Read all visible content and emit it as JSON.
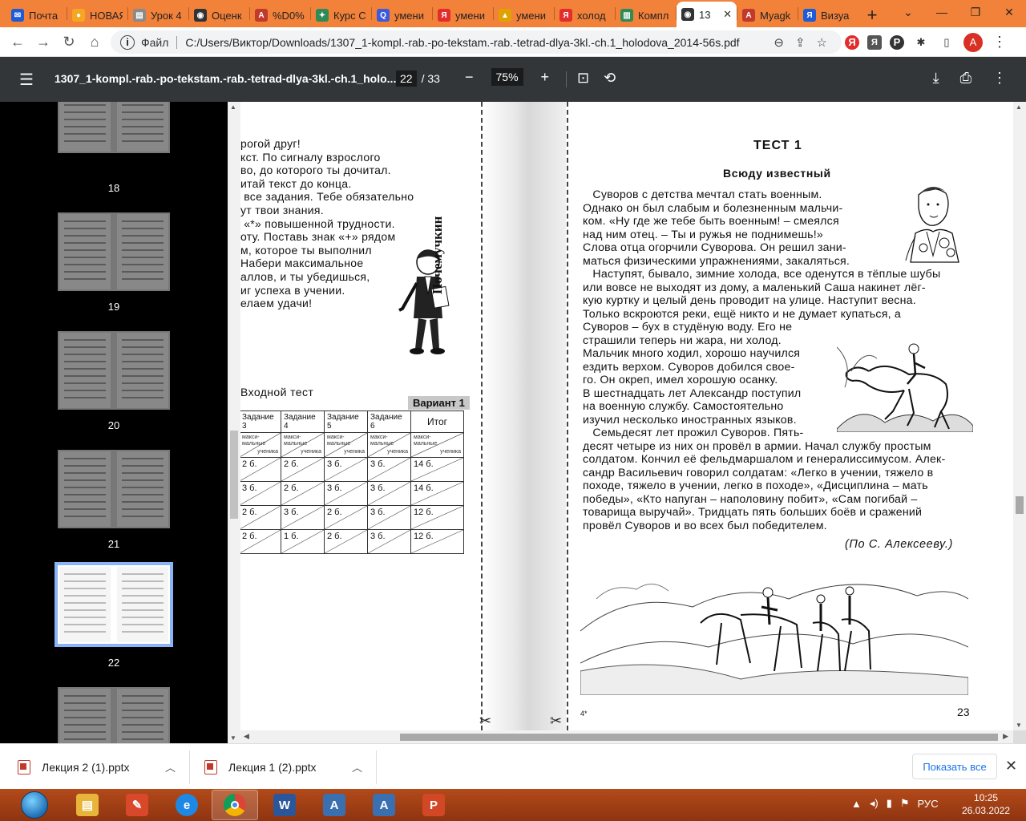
{
  "browser": {
    "tabs": [
      {
        "label": "Почта",
        "icon": "mail-icon",
        "color": "#1e5bd6"
      },
      {
        "label": "НОВАЯ",
        "icon": "yandex-icon",
        "color": "#f5a623"
      },
      {
        "label": "Урок 4",
        "icon": "document-icon",
        "color": "#8a8a8a"
      },
      {
        "label": "Оценк",
        "icon": "globe-icon",
        "color": "#333333"
      },
      {
        "label": "%D0%",
        "icon": "pdf-icon",
        "color": "#c0392b"
      },
      {
        "label": "Курс С",
        "icon": "puzzle-icon",
        "color": "#2e8b57"
      },
      {
        "label": "умени",
        "icon": "search-q-icon",
        "color": "#3b5bdb"
      },
      {
        "label": "умени",
        "icon": "yandex-y-icon",
        "color": "#e22d2d"
      },
      {
        "label": "умени",
        "icon": "image-icon",
        "color": "#e0a200"
      },
      {
        "label": "холод",
        "icon": "yandex-y-icon",
        "color": "#e22d2d"
      },
      {
        "label": "Компл",
        "icon": "book-icon",
        "color": "#2e8b57"
      },
      {
        "label": "13",
        "icon": "globe-icon",
        "color": "#333333",
        "active": true
      },
      {
        "label": "Myagk",
        "icon": "pdf-icon",
        "color": "#c0392b"
      },
      {
        "label": "Визуа",
        "icon": "bookmark-icon",
        "color": "#1e5bd6"
      }
    ],
    "address": {
      "scheme": "Файл",
      "url": "C:/Users/Виктор/Downloads/1307_1-kompl.-rab.-po-tekstam.-rab.-tetrad-dlya-3kl.-ch.1_holodova_2014-56s.pdf"
    },
    "avatar_letter": "A"
  },
  "pdf": {
    "title": "1307_1-kompl.-rab.-po-tekstam.-rab.-tetrad-dlya-3kl.-ch.1_holo...",
    "current_page": "22",
    "total_pages": "/ 33",
    "zoom": "75%"
  },
  "thumbnails": [
    "18",
    "19",
    "20",
    "21",
    "22"
  ],
  "left_page": {
    "lines": [
      "рогой друг!",
      "кст. По сигналу взрослого",
      "во, до которого ты дочитал.",
      "итай текст до конца.",
      " все задания. Тебе обязательно",
      "ут твои знания.",
      " «*» повышенной трудности.",
      "оту. Поставь знак «+» рядом",
      "м, которое ты выполнил",
      "Набери максимальное",
      "аллов, и ты убедишься,",
      "иг успеха в учении.",
      "елаем удачи!"
    ],
    "mascot": "Почемучкин",
    "test_title": "Входной тест",
    "variant": "Вариант 1",
    "table": {
      "headers": [
        "Задание 3",
        "Задание 4",
        "Задание 5",
        "Задание 6",
        "Итог"
      ],
      "sub_top": "макси-мальные",
      "sub_bottom": "ученика",
      "rows": [
        [
          "2 б.",
          "2 б.",
          "3 б.",
          "3 б.",
          "14 б."
        ],
        [
          "3 б.",
          "2 б.",
          "3 б.",
          "3 б.",
          "14 б."
        ],
        [
          "2 б.",
          "3 б.",
          "2 б.",
          "3 б.",
          "12 б."
        ],
        [
          "2 б.",
          "1 б.",
          "2 б.",
          "3 б.",
          "12 б."
        ]
      ]
    }
  },
  "right_page": {
    "test_title": "ТЕСТ 1",
    "story_title": "Всюду известный",
    "lines": [
      "   Суворов с детства мечтал стать военным.",
      "Однако он был слабым и болезненным мальчи-",
      "ком. «Ну где же тебе быть военным! – смеялся",
      "над ним отец. – Ты и ружья не поднимешь!»",
      "Слова отца огорчили Суворова. Он решил зани-",
      "маться физическими упражнениями, закаляться.",
      "   Наступят, бывало, зимние холода, все оденутся в тёплые шубы",
      "или вовсе не выходят из дому, а маленький Саша накинет лёг-",
      "кую куртку и целый день проводит на улице. Наступит весна.",
      "Только вскроются реки, ещё никто и не думает купаться, а",
      "Суворов – бух в студёную воду. Его не",
      "страшили теперь ни жара, ни холод.",
      "Мальчик много ходил, хорошо научился",
      "ездить верхом. Суворов добился свое-",
      "го. Он окреп, имел хорошую осанку.",
      "В шестнадцать лет Александр поступил",
      "на военную службу. Самостоятельно",
      "изучил несколько иностранных языков.",
      "   Семьдесят лет прожил Суворов. Пять-",
      "десят четыре из них он провёл в армии. Начал службу простым",
      "солдатом. Кончил её фельдмаршалом и генералиссимусом. Алек-",
      "сандр Васильевич говорил солдатам: «Легко в учении, тяжело в",
      "походе, тяжело в учении, легко в походе», «Дисциплина – мать",
      "победы», «Кто напуган – наполовину побит», «Сам погибай –",
      "товарища выручай». Тридцать пять больших боёв и сражений",
      "провёл Суворов и во всех был победителем."
    ],
    "author": "(По С. Алексееву.)",
    "page_number": "23",
    "signature": "4*"
  },
  "downloads": [
    {
      "name": "Лекция 2 (1).pptx"
    },
    {
      "name": "Лекция 1 (2).pptx"
    }
  ],
  "downloads_show_all": "Показать все",
  "taskbar": {
    "language": "РУС",
    "time": "10:25",
    "date": "26.03.2022"
  }
}
